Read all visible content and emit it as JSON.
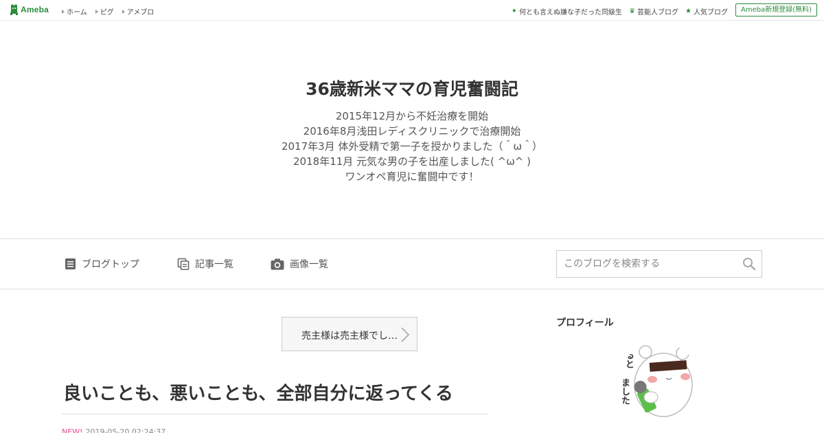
{
  "topbar": {
    "logo_text": "Ameba",
    "nav": [
      "ホーム",
      "ピグ",
      "アメブロ"
    ],
    "links": [
      {
        "icon": "sparkle-icon",
        "label": "何とも言えぬ嫌な子だった同級生"
      },
      {
        "icon": "crown-icon",
        "label": "芸能人ブログ"
      },
      {
        "icon": "star-icon",
        "label": "人気ブログ"
      }
    ],
    "signup_label": "Ameba新規登録(無料)",
    "brand_color": "#2d8c3c"
  },
  "header": {
    "title": "36歳新米ママの育児奮闘記",
    "description": [
      "2015年12月から不妊治療を開始",
      "2016年8月浅田レディスクリニックで治療開始",
      "2017年3月 体外受精で第一子を授かりました（＾ω＾）",
      "2018年11月 元気な男の子を出産しました( ^ω^ )",
      "ワンオペ育児に奮闘中です！"
    ]
  },
  "blognav": {
    "items": [
      {
        "icon": "document-icon",
        "label": "ブログトップ"
      },
      {
        "icon": "pages-icon",
        "label": "記事一覧"
      },
      {
        "icon": "camera-icon",
        "label": "画像一覧"
      }
    ],
    "search_placeholder": "このブログを検索する"
  },
  "main": {
    "prev_entry_label": "売主様は売主様でし…",
    "entry_title": "良いことも、悪いことも、全部自分に返ってくる",
    "new_badge": "NEW!",
    "timestamp": "2019-05-20 02:24:37"
  },
  "sidebar": {
    "profile_heading": "プロフィール",
    "avatar_text": [
      "ると",
      "ました"
    ]
  }
}
